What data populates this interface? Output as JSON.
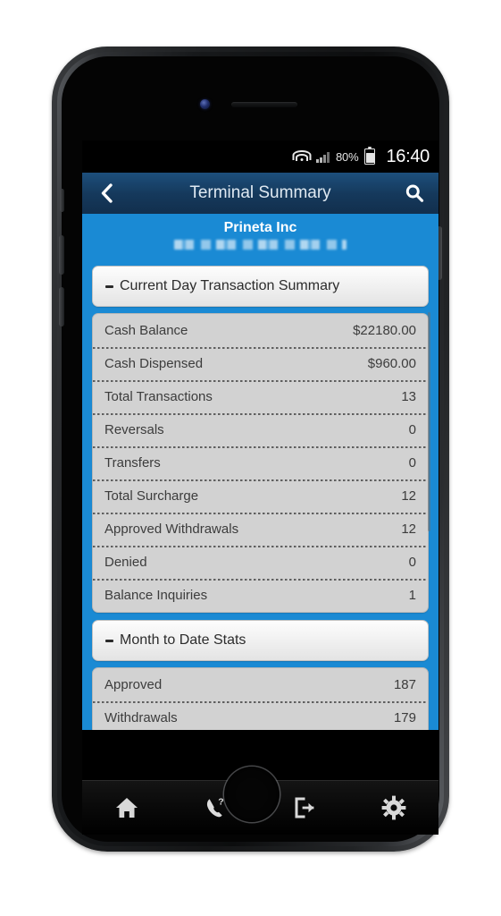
{
  "status_bar": {
    "battery_percent": "80%",
    "clock": "16:40",
    "wifi_icon": "wifi-icon",
    "signal_icon": "signal-bars-icon",
    "battery_icon": "battery-icon"
  },
  "title_bar": {
    "back_icon": "back-chevron-icon",
    "title": "Terminal Summary",
    "search_icon": "search-icon"
  },
  "sub_header": {
    "company_name": "Prineta Inc",
    "company_subtitle_redacted": "[redacted]"
  },
  "sections": [
    {
      "header": "Current Day Transaction Summary",
      "collapse_icon": "minus-icon",
      "rows": [
        {
          "label": "Cash Balance",
          "value": "$22180.00"
        },
        {
          "label": "Cash Dispensed",
          "value": "$960.00"
        },
        {
          "label": "Total Transactions",
          "value": "13"
        },
        {
          "label": "Reversals",
          "value": "0"
        },
        {
          "label": "Transfers",
          "value": "0"
        },
        {
          "label": "Total Surcharge",
          "value": "12"
        },
        {
          "label": "Approved Withdrawals",
          "value": "12"
        },
        {
          "label": "Denied",
          "value": "0"
        },
        {
          "label": "Balance Inquiries",
          "value": "1"
        }
      ]
    },
    {
      "header": "Month to Date Stats",
      "collapse_icon": "minus-icon",
      "rows": [
        {
          "label": "Approved",
          "value": "187"
        },
        {
          "label": "Withdrawals",
          "value": "179"
        }
      ]
    }
  ],
  "tab_bar": {
    "tabs": [
      {
        "name": "home",
        "icon": "home-icon"
      },
      {
        "name": "support",
        "icon": "phone-help-icon"
      },
      {
        "name": "logout",
        "icon": "logout-icon"
      },
      {
        "name": "settings",
        "icon": "gear-icon"
      }
    ]
  },
  "colors": {
    "title_bar": "#15395c",
    "sub_header": "#1a8ad4",
    "row_background": "#d2d2d2",
    "section_head": "#f1f1f1",
    "tab_bar": "#0a0a0a"
  }
}
